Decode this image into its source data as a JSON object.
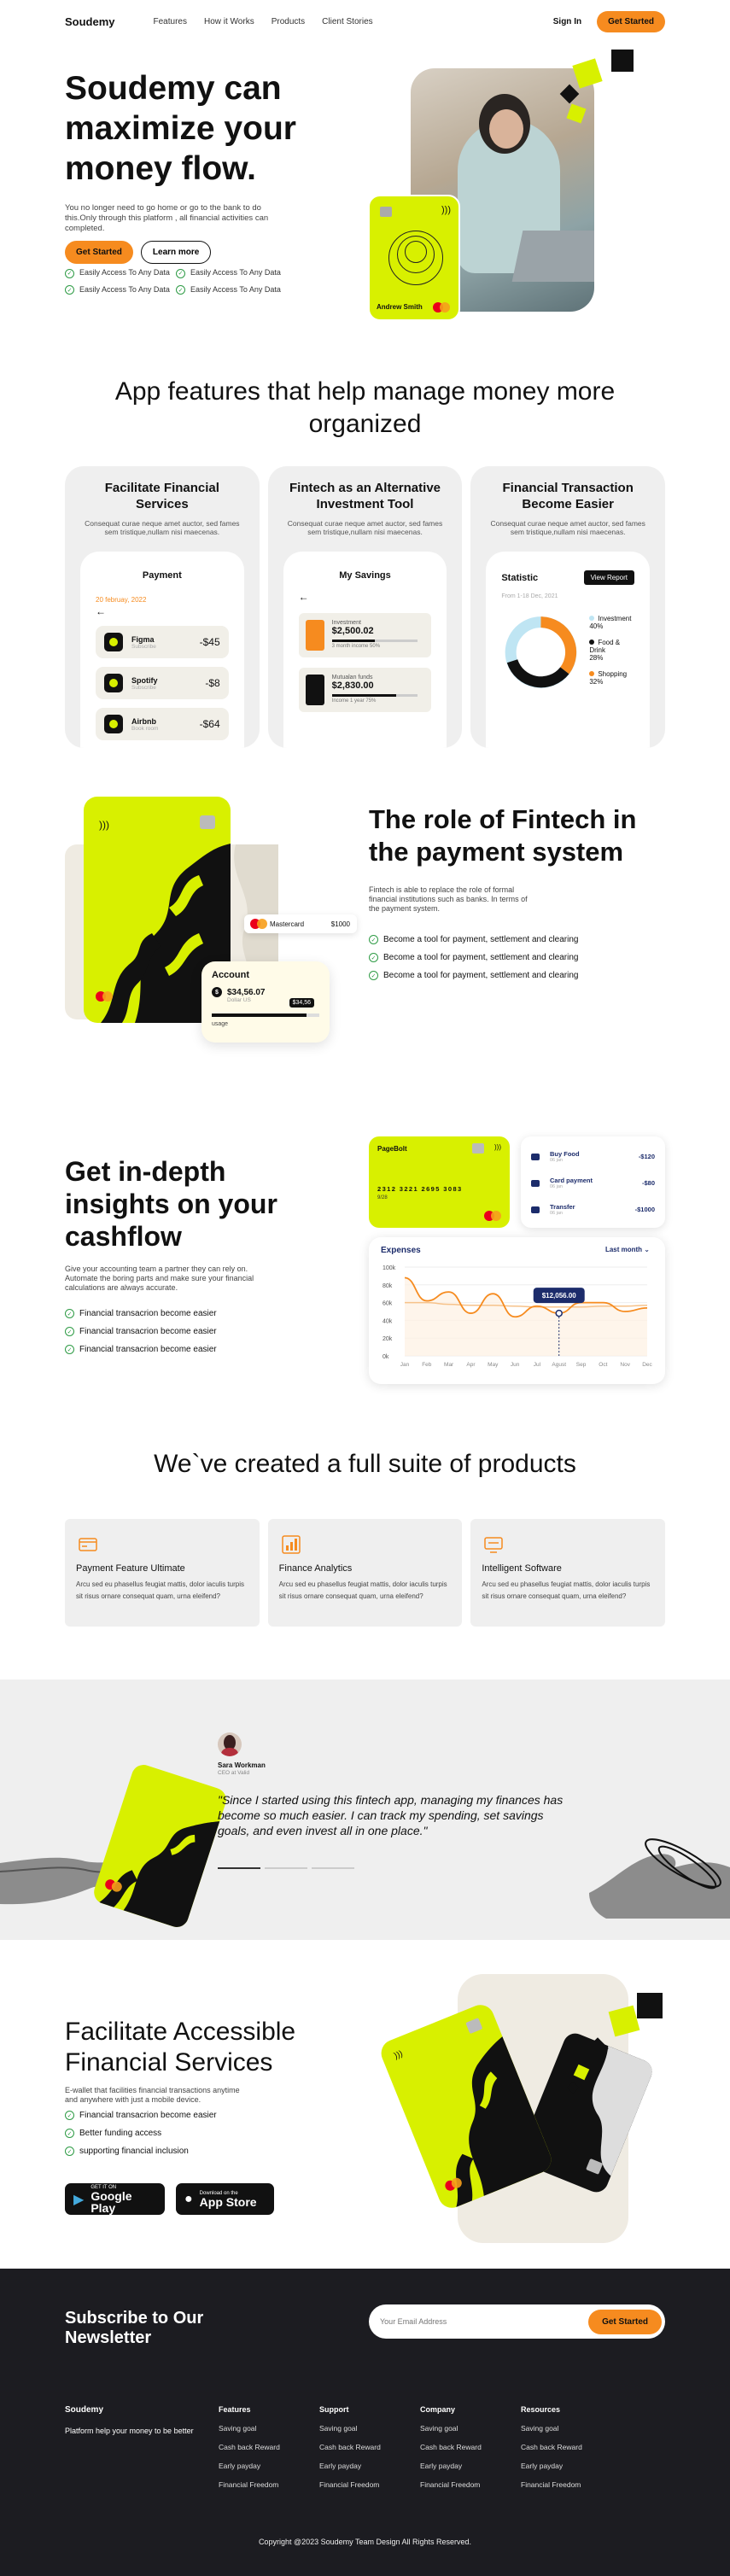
{
  "nav": {
    "logo": "Soudemy",
    "links": [
      "Features",
      "How it Works",
      "Products",
      "Client Stories"
    ],
    "signin": "Sign In",
    "cta": "Get Started"
  },
  "hero": {
    "title": "Soudemy can maximize your money flow.",
    "subtitle": "You no longer need to go home or go to the bank to do this.Only through this platform , all financial activities can completed.",
    "primary": "Get Started",
    "secondary": "Learn more",
    "features": [
      "Easily Access To Any Data",
      "Easily Access To Any Data",
      "Easily Access To Any Data",
      "Easily Access To Any Data"
    ],
    "card_holder": "Andrew Smith"
  },
  "features": {
    "title": "App features that help manage money more organized",
    "cards": [
      {
        "title": "Facilitate Financial Services",
        "desc": "Consequat curae neque amet auctor, sed fames sem tristique,nullam nisi maecenas."
      },
      {
        "title": "Fintech as an Alternative Investment Tool",
        "desc": "Consequat curae neque amet auctor, sed fames sem tristique,nullam nisi maecenas."
      },
      {
        "title": "Financial Transaction Become Easier",
        "desc": "Consequat curae neque amet auctor, sed fames sem tristique,nullam nisi maecenas."
      }
    ],
    "payment": {
      "title": "Payment",
      "date": "20 februay, 2022",
      "items": [
        {
          "name": "Figma",
          "sub": "Subscribe",
          "amount": "-$45"
        },
        {
          "name": "Spotify",
          "sub": "Subscribe",
          "amount": "-$8"
        },
        {
          "name": "Airbnb",
          "sub": "Book room",
          "amount": "-$64"
        }
      ]
    },
    "savings": {
      "title": "My Savings",
      "items": [
        {
          "label": "Investment",
          "amount": "$2,500.02",
          "note": "3 month income 50%",
          "progress": 0.5,
          "color": "#f68b1f"
        },
        {
          "label": "Mutualan funds",
          "amount": "$2,830.00",
          "note": "Income 1 year 75%",
          "progress": 0.75,
          "color": "#111111"
        }
      ]
    },
    "statistic": {
      "title": "Statistic",
      "button": "View Report",
      "date": "From 1-18 Dec, 2021",
      "legend": [
        {
          "label": "Investment",
          "value": "40%",
          "color": "#bfe5f3"
        },
        {
          "label": "Food & Drink",
          "value": "28%",
          "color": "#111111"
        },
        {
          "label": "Shopping",
          "value": "32%",
          "color": "#f68b1f"
        }
      ]
    }
  },
  "role": {
    "title": "The role of Fintech in the payment system",
    "desc": "Fintech is able to replace the role of formal financial institutions such as banks. In terms of the payment system.",
    "items": [
      "Become a tool for payment, settlement and clearing",
      "Become a tool for payment, settlement and clearing",
      "Become a tool for payment, settlement and clearing"
    ],
    "mini": {
      "brand": "Mastercard",
      "amount": "$1000"
    },
    "account": {
      "title": "Account",
      "amount": "$34,56.07",
      "sub": "Dollar US",
      "usage": "usage",
      "tip": "$34,56"
    }
  },
  "cashflow": {
    "title": "Get in-depth insights on your cashflow",
    "desc": "Give your accounting team a partner they can rely on. Automate the boring parts and make sure your financial calculations are always accurate.",
    "items": [
      "Financial transacrion become easier",
      "Financial transacrion become easier",
      "Financial transacrion become easier"
    ],
    "card": {
      "name": "PageBolt",
      "number": "2312 3221 2695 3083",
      "date": "9/28"
    },
    "transactions": [
      {
        "name": "Buy Food",
        "sub": "06 jan",
        "amount": "-$120"
      },
      {
        "name": "Card payment",
        "sub": "06 jan",
        "amount": "-$80"
      },
      {
        "name": "Transfer",
        "sub": "06 jan",
        "amount": "-$1000"
      }
    ],
    "chart_title": "Expenses",
    "chart_filter": "Last month",
    "tooltip": "$12,056.00"
  },
  "chart_data": {
    "type": "line",
    "title": "Expenses",
    "xlabel": "",
    "ylabel": "",
    "categories": [
      "Jan",
      "Feb",
      "Mar",
      "Apr",
      "May",
      "Jun",
      "Jul",
      "Agust",
      "Sep",
      "Oct",
      "Nov",
      "Dec"
    ],
    "yticks": [
      "100k",
      "80k",
      "60k",
      "40k",
      "20k",
      "0k"
    ],
    "ylim": [
      0,
      100
    ],
    "series": [
      {
        "values": [
          88,
          62,
          72,
          48,
          70,
          44,
          56,
          48,
          60,
          60,
          50,
          54
        ]
      },
      {
        "values": [
          60,
          60,
          58,
          57,
          57,
          56,
          55,
          55,
          55,
          56,
          56,
          57
        ]
      }
    ],
    "highlight_index": 7,
    "grid": true,
    "line_color": "#f68b1f"
  },
  "products": {
    "title": "We`ve created a full suite of products",
    "cards": [
      {
        "title": "Payment Feature Ultimate",
        "desc": "Arcu sed eu phasellus feugiat mattis, dolor iaculis turpis sit risus ornare consequat quam, urna eleifend?"
      },
      {
        "title": "Finance Analytics",
        "desc": "Arcu sed eu phasellus feugiat mattis, dolor iaculis turpis sit risus ornare consequat quam, urna eleifend?"
      },
      {
        "title": "Intelligent Software",
        "desc": "Arcu sed eu phasellus feugiat mattis, dolor iaculis turpis sit risus ornare consequat quam, urna eleifend?"
      }
    ]
  },
  "testimonial": {
    "name": "Sara Workman",
    "role": "CEO at Valid",
    "quote": "\"Since I started using this fintech app, managing my finances has become so much easier. I can track my spending, set savings goals, and even invest all in one place.\""
  },
  "facilitate": {
    "title": "Facilitate Accessible Financial Services",
    "desc": "E-wallet that facilities financial transactions anytime and anywhere with just a mobile device.",
    "items": [
      "Financial transacrion become easier",
      "Better funding access",
      "supporting financial inclusion"
    ],
    "google_small": "GET IT ON",
    "google": "Google Play",
    "apple_small": "Download on the",
    "apple": "App Store"
  },
  "footer": {
    "newsletter": "Subscribe to Our Newsletter",
    "placeholder": "Your Email Address",
    "subscribe": "Get Started",
    "brand": "Soudemy",
    "tagline": "Platform help your money to be better",
    "columns": [
      {
        "title": "Features",
        "links": [
          "Saving goal",
          "Cash back Reward",
          "Early payday",
          "Financial Freedom"
        ]
      },
      {
        "title": "Support",
        "links": [
          "Saving goal",
          "Cash back Reward",
          "Early payday",
          "Financial Freedom"
        ]
      },
      {
        "title": "Company",
        "links": [
          "Saving goal",
          "Cash back Reward",
          "Early payday",
          "Financial Freedom"
        ]
      },
      {
        "title": "Resources",
        "links": [
          "Saving goal",
          "Cash back Reward",
          "Early payday",
          "Financial Freedom"
        ]
      }
    ],
    "copyright": "Copyright @2023 Soudemy Team Design All Rights Reserved."
  }
}
